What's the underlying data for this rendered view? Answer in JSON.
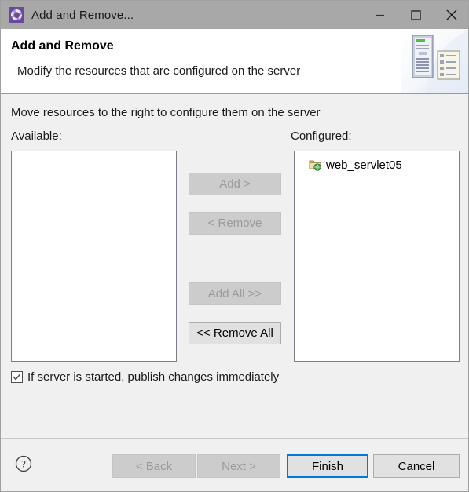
{
  "window": {
    "title": "Add and Remove...",
    "icon": "wizard-gear-icon",
    "controls": {
      "minimize": "minimize-icon",
      "maximize": "maximize-icon",
      "close": "close-icon"
    }
  },
  "header": {
    "title": "Add and Remove",
    "description": "Modify the resources that are configured on the server",
    "banner_icon": "server-and-document-icon"
  },
  "main": {
    "instruction": "Move resources to the right to configure them on the server",
    "available_label": "Available:",
    "configured_label": "Configured:",
    "available_items": [],
    "configured_items": [
      {
        "label": "web_servlet05",
        "icon": "web-project-icon"
      }
    ],
    "transfer_buttons": [
      {
        "label": "Add >",
        "name": "add-button",
        "enabled": false
      },
      {
        "label": "< Remove",
        "name": "remove-button",
        "enabled": false
      },
      {
        "label": "Add All >>",
        "name": "add-all-button",
        "enabled": false
      },
      {
        "label": "<< Remove All",
        "name": "remove-all-button",
        "enabled": true
      }
    ],
    "publish_checkbox": {
      "label": "If server is started, publish changes immediately",
      "checked": true
    }
  },
  "footer": {
    "help_icon": "help-question-icon",
    "back_label": "< Back",
    "next_label": "Next >",
    "finish_label": "Finish",
    "cancel_label": "Cancel",
    "back_enabled": false,
    "next_enabled": false
  },
  "colors": {
    "titlebar": "#a8a8a8",
    "dialog_bg": "#f0f0f0",
    "default_button_border": "#0078d7",
    "disabled_text": "#9a9a9a"
  }
}
